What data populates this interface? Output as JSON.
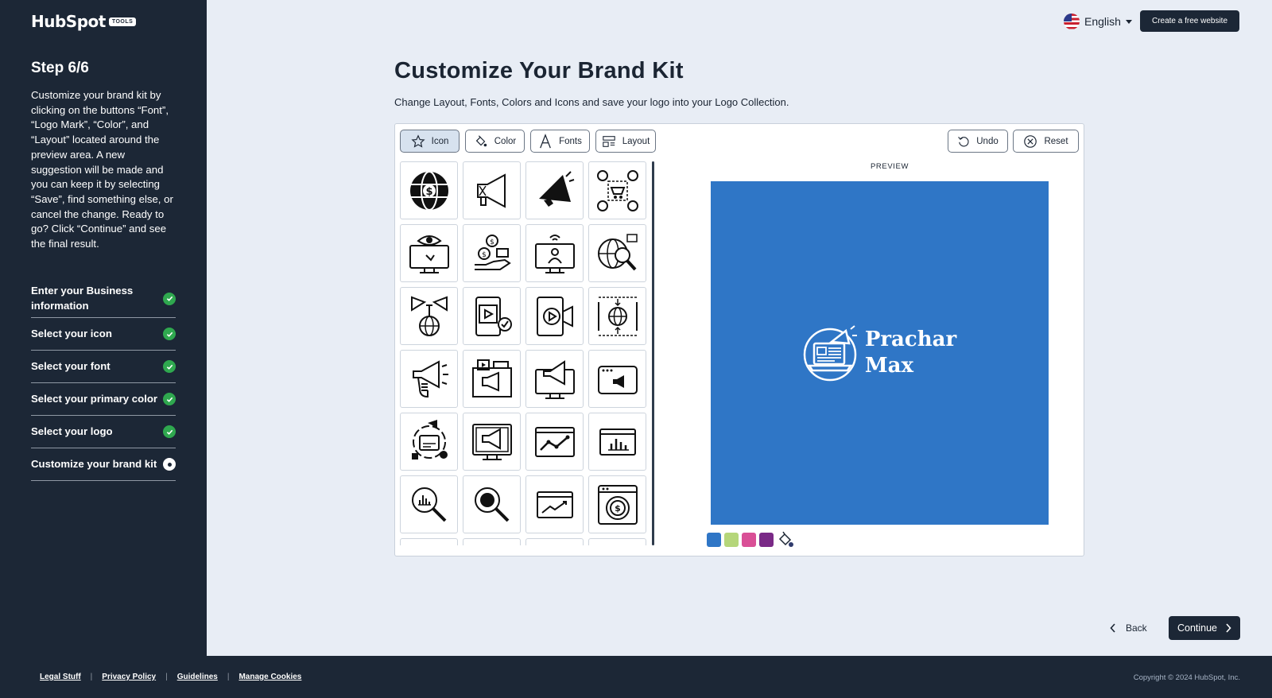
{
  "sidebar": {
    "logo_text": "HubSpot",
    "logo_badge": "TOOLS",
    "step_title": "Step 6/6",
    "step_description": "Customize your brand kit by clicking on the buttons “Font”, “Logo Mark”, “Color”, and “Layout” located around the preview area. A new suggestion will be made and you can keep it by selecting “Save”, find something else, or cancel the change. Ready to go? Click “Continue” and see the final result.",
    "steps": [
      {
        "label": "Enter your Business information",
        "status": "done"
      },
      {
        "label": "Select your icon",
        "status": "done"
      },
      {
        "label": "Select your font",
        "status": "done"
      },
      {
        "label": "Select your primary color",
        "status": "done"
      },
      {
        "label": "Select your logo",
        "status": "done"
      },
      {
        "label": "Customize your brand kit",
        "status": "current"
      }
    ]
  },
  "header": {
    "language": "English",
    "create_button": "Create a free website"
  },
  "main": {
    "title": "Customize Your Brand Kit",
    "subtitle": "Change Layout, Fonts, Colors and Icons and save your logo into your Logo Collection.",
    "toolbar": {
      "icon": "Icon",
      "color": "Color",
      "fonts": "Fonts",
      "layout": "Layout",
      "undo": "Undo",
      "reset": "Reset"
    },
    "preview_label": "PREVIEW",
    "brand_line1": "Prachar",
    "brand_line2": "Max",
    "preview_color": "#2f76c6",
    "swatch_colors": [
      "#2f76c6",
      "#b5d67a",
      "#d94f96",
      "#7a2a87"
    ],
    "icons": [
      "globe-dollar-icon",
      "megaphone-outline-icon",
      "megaphone-solid-icon",
      "network-cart-icon",
      "monitor-eye-icon",
      "money-hand-icon",
      "monitor-broadcast-icon",
      "globe-search-icon",
      "speaker-globe-icon",
      "mobile-video-icon",
      "video-camera-phone-icon",
      "globe-arrows-icon",
      "hand-megaphone-icon",
      "billboard-icon",
      "monitor-megaphone-icon",
      "browser-megaphone-icon",
      "social-cycle-icon",
      "monitor-speaker-icon",
      "line-chart-screen-icon",
      "bar-chart-screen-icon",
      "magnifier-chart-icon",
      "magnifier-solid-icon",
      "growth-screen-icon",
      "browser-dollar-icon",
      "partial-icon-1",
      "partial-icon-2",
      "partial-icon-3",
      "partial-icon-4"
    ]
  },
  "nav": {
    "back": "Back",
    "continue": "Continue"
  },
  "footer": {
    "links": [
      "Legal Stuff",
      "Privacy Policy",
      "Guidelines",
      "Manage Cookies"
    ],
    "copyright": "Copyright © 2024 HubSpot, Inc."
  }
}
